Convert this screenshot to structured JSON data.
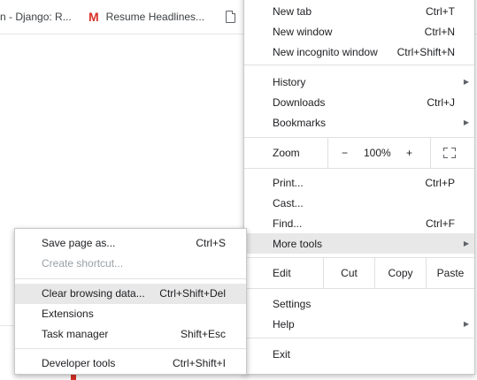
{
  "bookmarks": [
    {
      "label": "n - Django: R..."
    },
    {
      "label": "Resume Headlines...",
      "icon": "gmail-icon"
    },
    {
      "label": "",
      "icon": "document-icon"
    }
  ],
  "menu": {
    "new_tab": {
      "label": "New tab",
      "shortcut": "Ctrl+T"
    },
    "new_window": {
      "label": "New window",
      "shortcut": "Ctrl+N"
    },
    "new_incognito": {
      "label": "New incognito window",
      "shortcut": "Ctrl+Shift+N"
    },
    "history": {
      "label": "History"
    },
    "downloads": {
      "label": "Downloads",
      "shortcut": "Ctrl+J"
    },
    "bookmarks": {
      "label": "Bookmarks"
    },
    "zoom": {
      "label": "Zoom",
      "minus": "−",
      "value": "100%",
      "plus": "+"
    },
    "print": {
      "label": "Print...",
      "shortcut": "Ctrl+P"
    },
    "cast": {
      "label": "Cast..."
    },
    "find": {
      "label": "Find...",
      "shortcut": "Ctrl+F"
    },
    "more_tools": {
      "label": "More tools"
    },
    "edit": {
      "label": "Edit",
      "cut": "Cut",
      "copy": "Copy",
      "paste": "Paste"
    },
    "settings": {
      "label": "Settings"
    },
    "help": {
      "label": "Help"
    },
    "exit": {
      "label": "Exit"
    }
  },
  "submenu": {
    "save_page": {
      "label": "Save page as...",
      "shortcut": "Ctrl+S"
    },
    "create_shortcut": {
      "label": "Create shortcut..."
    },
    "clear_browsing": {
      "label": "Clear browsing data...",
      "shortcut": "Ctrl+Shift+Del"
    },
    "extensions": {
      "label": "Extensions"
    },
    "task_manager": {
      "label": "Task manager",
      "shortcut": "Shift+Esc"
    },
    "developer_tools": {
      "label": "Developer tools",
      "shortcut": "Ctrl+Shift+I"
    }
  },
  "colors": {
    "hover": "#e8e8e8",
    "separator": "#e0e0e0",
    "gmail": "#d93025"
  }
}
